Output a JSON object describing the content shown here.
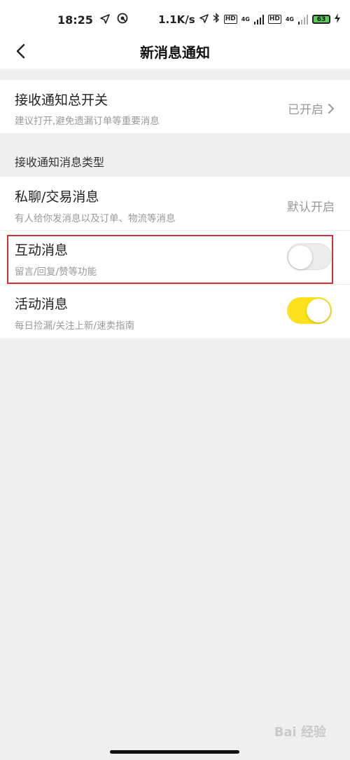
{
  "status_bar": {
    "time": "18:25",
    "network_speed": "1.1K/s",
    "network_1": "4G",
    "network_2": "4G",
    "hd_1": "HD",
    "hd_2": "HD",
    "battery_level": "63",
    "icons": [
      "location-arrow-icon",
      "app-notification-icon",
      "bluetooth-icon",
      "signal-icon",
      "battery-icon",
      "charging-icon"
    ]
  },
  "header": {
    "title": "新消息通知",
    "back_icon": "chevron-left-icon"
  },
  "master_switch": {
    "title": "接收通知总开关",
    "subtitle": "建议打开,避免遗漏订单等重要消息",
    "value": "已开启"
  },
  "section_label": "接收通知消息类型",
  "items": [
    {
      "title": "私聊/交易消息",
      "subtitle": "有人给你发消息以及订单、物流等消息",
      "value": "默认开启"
    },
    {
      "title": "互动消息",
      "subtitle": "留言/回复/赞等功能",
      "enabled": false
    },
    {
      "title": "活动消息",
      "subtitle": "每日捡漏/关注上新/速卖指南",
      "enabled": true
    }
  ],
  "colors": {
    "toggle_on": "#fde21b",
    "toggle_off": "#ececec",
    "highlight_border": "#d0323a",
    "background": "#efefef"
  },
  "watermark": "Bai 经验"
}
